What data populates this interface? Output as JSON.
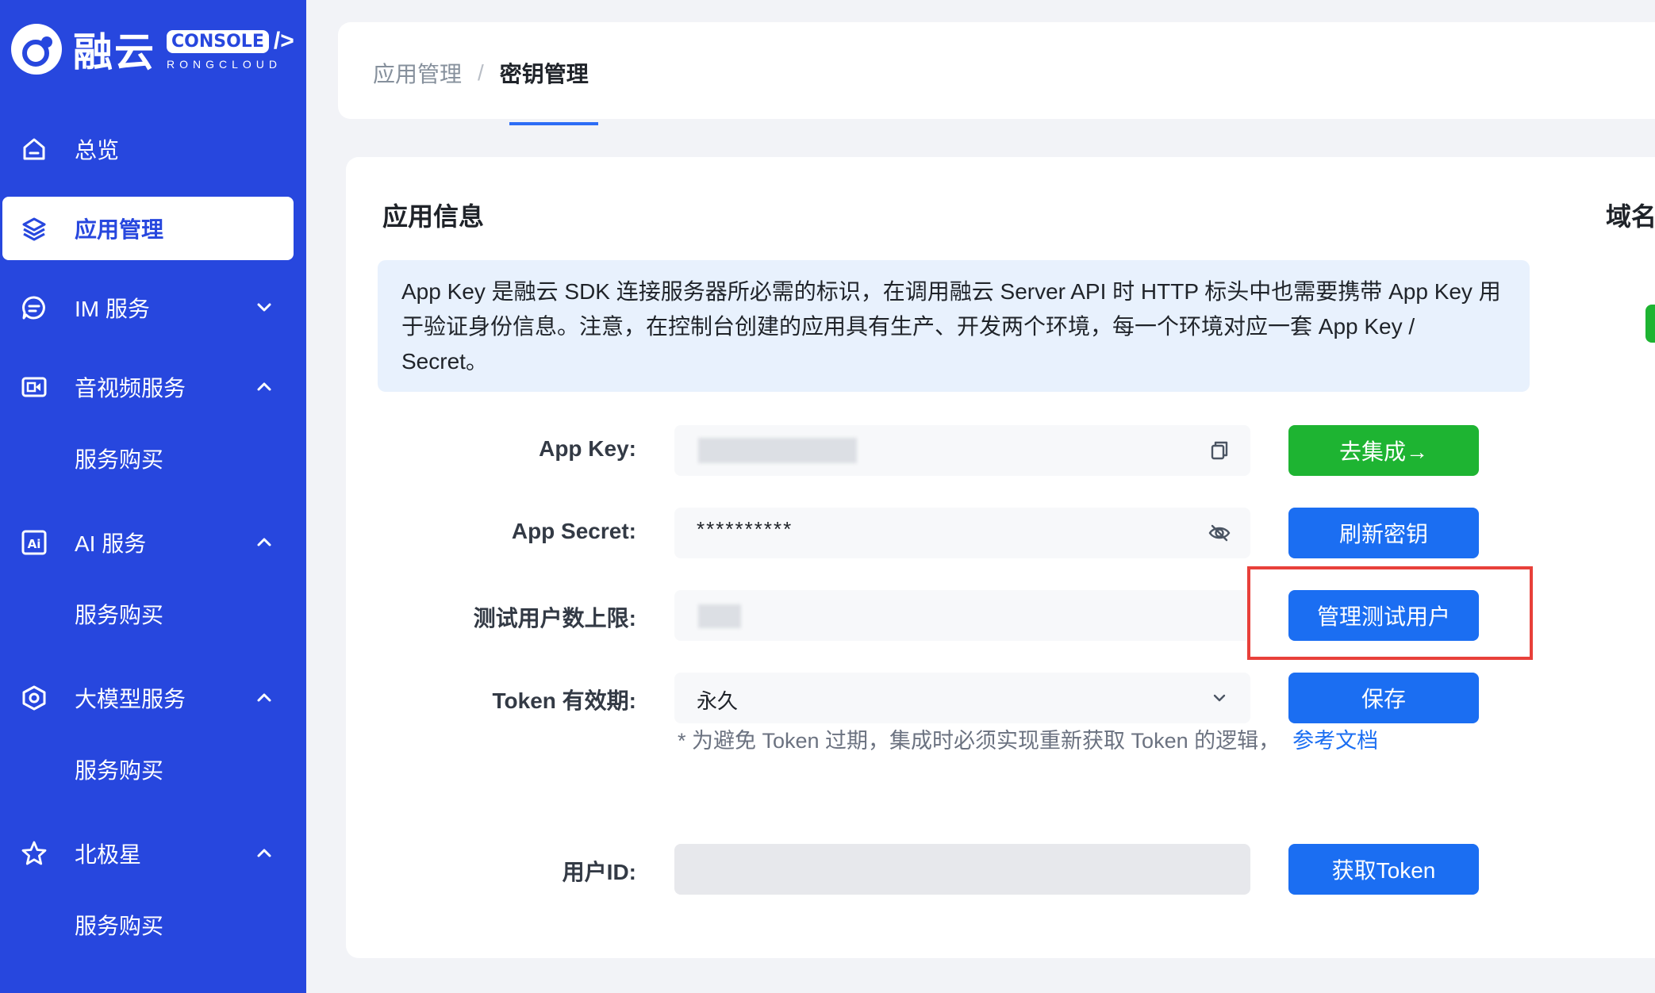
{
  "brand": {
    "name": "融云",
    "console": "CONSOLE",
    "console_arrow": "/>",
    "sub": "RONGCLOUD"
  },
  "sidebar": {
    "items": [
      {
        "label": "总览",
        "icon": "home-icon"
      },
      {
        "label": "应用管理",
        "icon": "layers-icon",
        "active": true
      },
      {
        "label": "IM 服务",
        "icon": "chat-icon",
        "expanded": false
      },
      {
        "label": "音视频服务",
        "icon": "video-icon",
        "expanded": true,
        "sub": "服务购买"
      },
      {
        "label": "AI 服务",
        "icon": "ai-icon",
        "expanded": true,
        "sub": "服务购买"
      },
      {
        "label": "大模型服务",
        "icon": "model-icon",
        "expanded": true,
        "sub": "服务购买"
      },
      {
        "label": "北极星",
        "icon": "star-icon",
        "expanded": true,
        "sub": "服务购买"
      }
    ]
  },
  "breadcrumb": {
    "parent": "应用管理",
    "separator": "/",
    "current": "密钥管理"
  },
  "main": {
    "section_title": "应用信息",
    "right_title": "域名",
    "info_text": "App Key 是融云 SDK 连接服务器所必需的标识，在调用融云 Server API 时 HTTP 标头中也需要携带 App Key 用于验证身份信息。注意，在控制台创建的应用具有生产、开发两个环境，每一个环境对应一套 App Key / Secret。",
    "rows": {
      "app_key": {
        "label": "App Key:",
        "button": "去集成→"
      },
      "app_secret": {
        "label": "App Secret:",
        "value": "**********",
        "button": "刷新密钥"
      },
      "test_limit": {
        "label": "测试用户数上限:",
        "button": "管理测试用户"
      },
      "token": {
        "label": "Token 有效期:",
        "value": "永久",
        "button": "保存"
      },
      "user_id": {
        "label": "用户ID:",
        "button": "获取Token"
      }
    },
    "hint": "* 为避免 Token 过期，集成时必须实现重新获取 Token 的逻辑，",
    "hint_link": "参考文档"
  },
  "colors": {
    "sidebar": "#2747de",
    "primary": "#1b6ef2",
    "success": "#1eb432",
    "highlight": "#e8403a"
  }
}
